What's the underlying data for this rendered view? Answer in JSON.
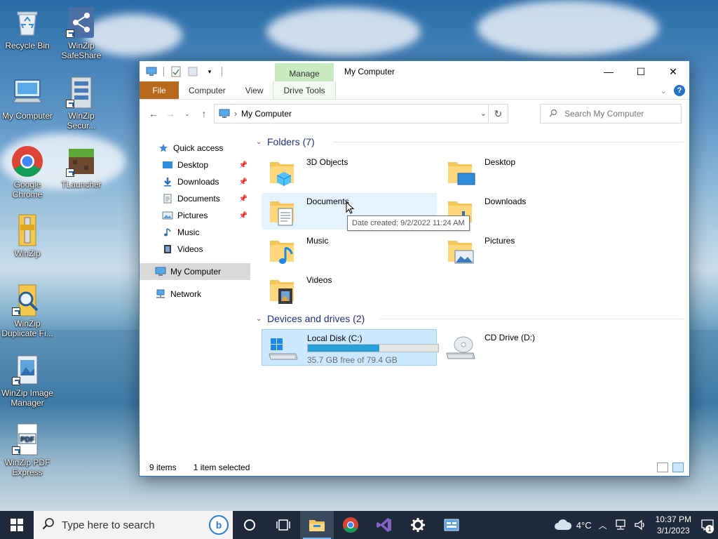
{
  "desktop": {
    "icons": [
      {
        "label": "Recycle Bin"
      },
      {
        "label": "WinZip SafeShare"
      },
      {
        "label": "My Computer"
      },
      {
        "label": "WinZip Secur..."
      },
      {
        "label": "Google Chrome"
      },
      {
        "label": "TLauncher"
      },
      {
        "label": "WinZip"
      },
      {
        "label": "WinZip Duplicate Fi..."
      },
      {
        "label": "WinZip Image Manager"
      },
      {
        "label": "WinZip PDF Express"
      }
    ]
  },
  "window": {
    "title": "My Computer",
    "contextual_tab": "Manage",
    "ribbon_tabs": [
      "File",
      "Computer",
      "View",
      "Drive Tools"
    ],
    "controls": {
      "minimize": "—",
      "maximize": "☐",
      "close": "✕"
    }
  },
  "address": {
    "path": "My Computer",
    "search_placeholder": "Search My Computer"
  },
  "navpane": {
    "quick_access": "Quick access",
    "items": [
      "Desktop",
      "Downloads",
      "Documents",
      "Pictures",
      "Music",
      "Videos"
    ],
    "this_pc": "My Computer",
    "network": "Network"
  },
  "content": {
    "folders_header": "Folders (7)",
    "folders": [
      "3D Objects",
      "Desktop",
      "Documents",
      "Downloads",
      "Music",
      "Pictures",
      "Videos"
    ],
    "devices_header": "Devices and drives (2)",
    "drives": [
      {
        "name": "Local Disk (C:)",
        "free": "35.7 GB free of 79.4 GB",
        "used_fraction": 0.55
      },
      {
        "name": "CD Drive (D:)"
      }
    ],
    "tooltip": "Date created: 9/2/2022 11:24 AM"
  },
  "status": {
    "items": "9 items",
    "selected": "1 item selected"
  },
  "taskbar": {
    "search_placeholder": "Type here to search",
    "weather": "4°C",
    "time": "10:37 PM",
    "date": "3/1/2023",
    "notifications": "1"
  },
  "colors": {
    "accent": "#0078d7",
    "file_tab": "#b8691b",
    "manage_tab": "#c7eac0",
    "drive_fill": "#26a0da",
    "taskbar": "#1f2b3a"
  }
}
